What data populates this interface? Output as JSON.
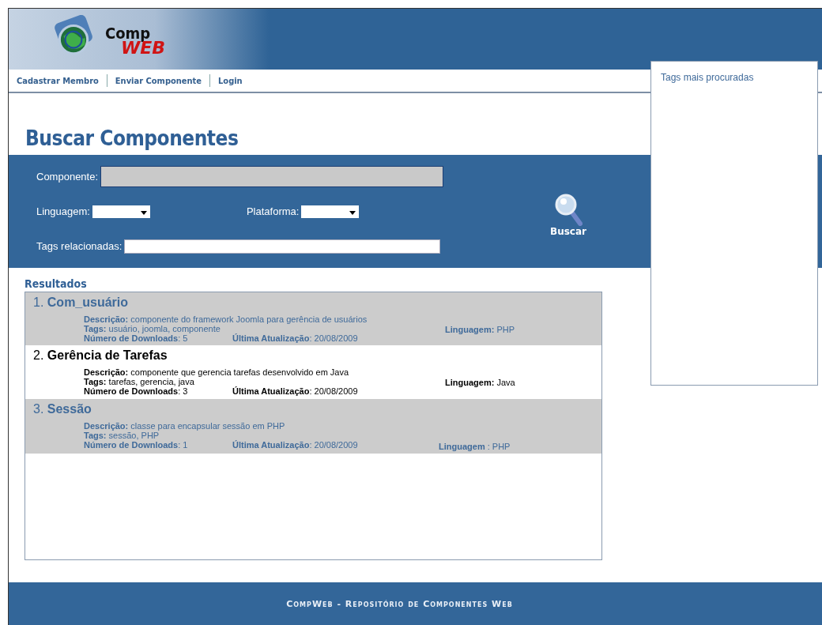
{
  "logo": {
    "line_1": "Comp",
    "line_2": "WEB"
  },
  "nav": [
    "Cadastrar Membro",
    "Enviar Componente",
    "Login"
  ],
  "sidebar": {
    "title": "Tags mais procuradas"
  },
  "page_title": "Buscar Componentes",
  "search": {
    "component_label": "Componente:",
    "language_label": "Linguagem:",
    "platform_label": "Plataforma:",
    "tags_label": "Tags relacionadas:",
    "button": "Buscar"
  },
  "results_title": "Resultados",
  "results": [
    {
      "number": "1.",
      "name": "Com_usuário",
      "shaded": true,
      "description_label": "Descrição:",
      "description": "componente do framework Joomla para gerência de usuários",
      "tags_label": "Tags:",
      "tags": "usuário, joomla, componente",
      "downloads_label": "Número de Downloads",
      "downloads": ": 5",
      "updated_label": "Última Atualização",
      "updated": ": 20/08/2009",
      "language_label": "Linguagem:",
      "language": "PHP"
    },
    {
      "number": "2.",
      "name": "Gerência de Tarefas",
      "shaded": false,
      "description_label": "Descrição:",
      "description": "componente que gerencia tarefas desenvolvido em Java",
      "tags_label": "Tags:",
      "tags": "tarefas, gerencia, java",
      "downloads_label": "Número de Downloads",
      "downloads": ": 3",
      "updated_label": "Última Atualização",
      "updated": ": 20/08/2009",
      "language_label": "Linguagem:",
      "language": "Java"
    },
    {
      "number": "3.",
      "name": "Sessão",
      "shaded": true,
      "description_label": "Descrição:",
      "description": "classe para encapsular sessão em PHP",
      "tags_label": "Tags:",
      "tags": "sessão, PHP",
      "downloads_label": "Número de Downloads",
      "downloads": ": 1",
      "updated_label": "Última Atualização",
      "updated": ": 20/08/2009",
      "language_label": "Linguagem",
      "language": ": PHP"
    }
  ],
  "footer": "CompWeb - Repositório de Componentes Web"
}
